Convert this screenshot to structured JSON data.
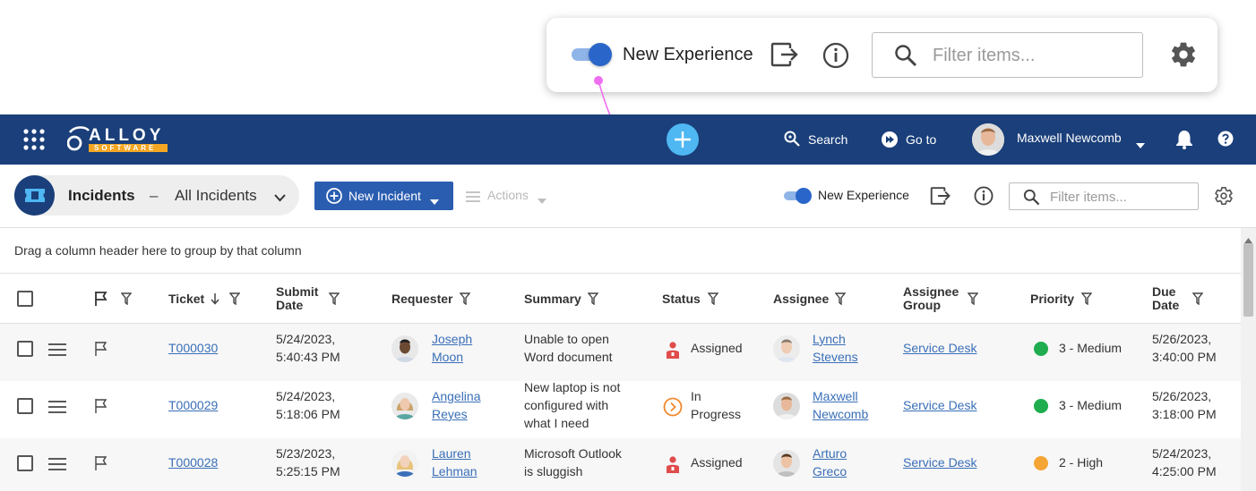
{
  "callout": {
    "toggle_label": "New Experience",
    "toggle_on": true,
    "filter_placeholder": "Filter items..."
  },
  "navbar": {
    "logo_text": "ALLOY",
    "logo_sub": "SOFTWARE",
    "search_label": "Search",
    "goto_label": "Go to",
    "user_name": "Maxwell Newcomb",
    "colors": {
      "bar": "#1a3f7a",
      "add_button": "#4fb7f2",
      "logo_accent": "#f5a623"
    }
  },
  "toolbar": {
    "module_title": "Incidents",
    "separator": "–",
    "view_name": "All Incidents",
    "new_button_label": "New Incident",
    "actions_label": "Actions",
    "toggle_label": "New Experience",
    "filter_placeholder": "Filter items..."
  },
  "grid": {
    "group_hint": "Drag a column header here to group by that column",
    "columns": {
      "ticket": "Ticket",
      "submit_1": "Submit",
      "submit_2": "Date",
      "requester": "Requester",
      "summary": "Summary",
      "status": "Status",
      "assignee": "Assignee",
      "group_1": "Assignee",
      "group_2": "Group",
      "priority": "Priority",
      "due_1": "Due",
      "due_2": "Date"
    },
    "rows": [
      {
        "ticket": "T000030",
        "submit_1": "5/24/2023,",
        "submit_2": "5:40:43 PM",
        "requester_1": "Joseph",
        "requester_2": "Moon",
        "summary_1": "Unable to open",
        "summary_2": "Word document",
        "summary_3": "",
        "status_1": "Assigned",
        "status_2": "",
        "status_icon": "assigned-icon",
        "assignee_1": "Lynch",
        "assignee_2": "Stevens",
        "group": "Service Desk",
        "priority": "3 - Medium",
        "priority_color": "#1fad4f",
        "due_1": "5/26/2023,",
        "due_2": "3:40:00 PM"
      },
      {
        "ticket": "T000029",
        "submit_1": "5/24/2023,",
        "submit_2": "5:18:06 PM",
        "requester_1": "Angelina",
        "requester_2": "Reyes",
        "summary_1": "New laptop is not",
        "summary_2": "configured with",
        "summary_3": "what I need",
        "status_1": "In",
        "status_2": "Progress",
        "status_icon": "in-progress-icon",
        "assignee_1": "Maxwell",
        "assignee_2": "Newcomb",
        "group": "Service Desk",
        "priority": "3 - Medium",
        "priority_color": "#1fad4f",
        "due_1": "5/26/2023,",
        "due_2": "3:18:00 PM"
      },
      {
        "ticket": "T000028",
        "submit_1": "5/23/2023,",
        "submit_2": "5:25:15 PM",
        "requester_1": "Lauren",
        "requester_2": "Lehman",
        "summary_1": "Microsoft Outlook",
        "summary_2": "is sluggish",
        "summary_3": "",
        "status_1": "Assigned",
        "status_2": "",
        "status_icon": "assigned-icon",
        "assignee_1": "Arturo",
        "assignee_2": "Greco",
        "group": "Service Desk",
        "priority": "2 - High",
        "priority_color": "#f5a533",
        "due_1": "5/24/2023,",
        "due_2": "4:25:00 PM"
      }
    ]
  }
}
